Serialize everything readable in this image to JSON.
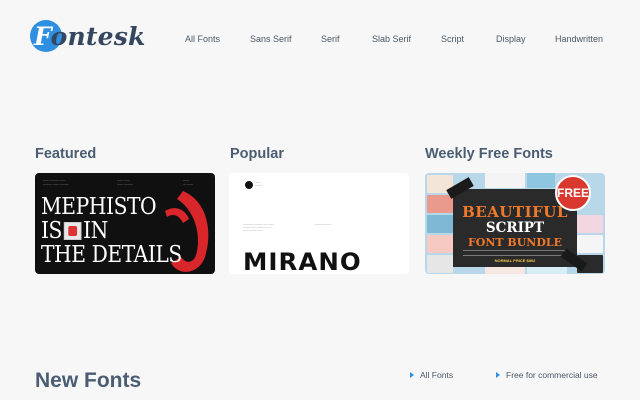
{
  "brand": {
    "name": "Fontesk",
    "accent": "#2f8fe0"
  },
  "nav": [
    {
      "label": "All Fonts"
    },
    {
      "label": "Sans Serif"
    },
    {
      "label": "Serif"
    },
    {
      "label": "Slab Serif"
    },
    {
      "label": "Script"
    },
    {
      "label": "Display"
    },
    {
      "label": "Handwritten"
    }
  ],
  "sections": {
    "featured": {
      "title": "Featured",
      "lines": [
        "MEPHISTO",
        "IS",
        "IN",
        "THE DETAILS"
      ]
    },
    "popular": {
      "title": "Popular",
      "word": "MIRANO"
    },
    "weekly": {
      "title": "Weekly Free Fonts",
      "line1": "BEAUTIFUL",
      "line2": "SCRIPT",
      "line3": "FONT BUNDLE",
      "price": "NORMAL PRICE $802",
      "badge": "FREE"
    }
  },
  "new_fonts": {
    "title": "New Fonts",
    "filters": [
      {
        "label": "All Fonts"
      },
      {
        "label": "Free for commercial use"
      }
    ]
  }
}
